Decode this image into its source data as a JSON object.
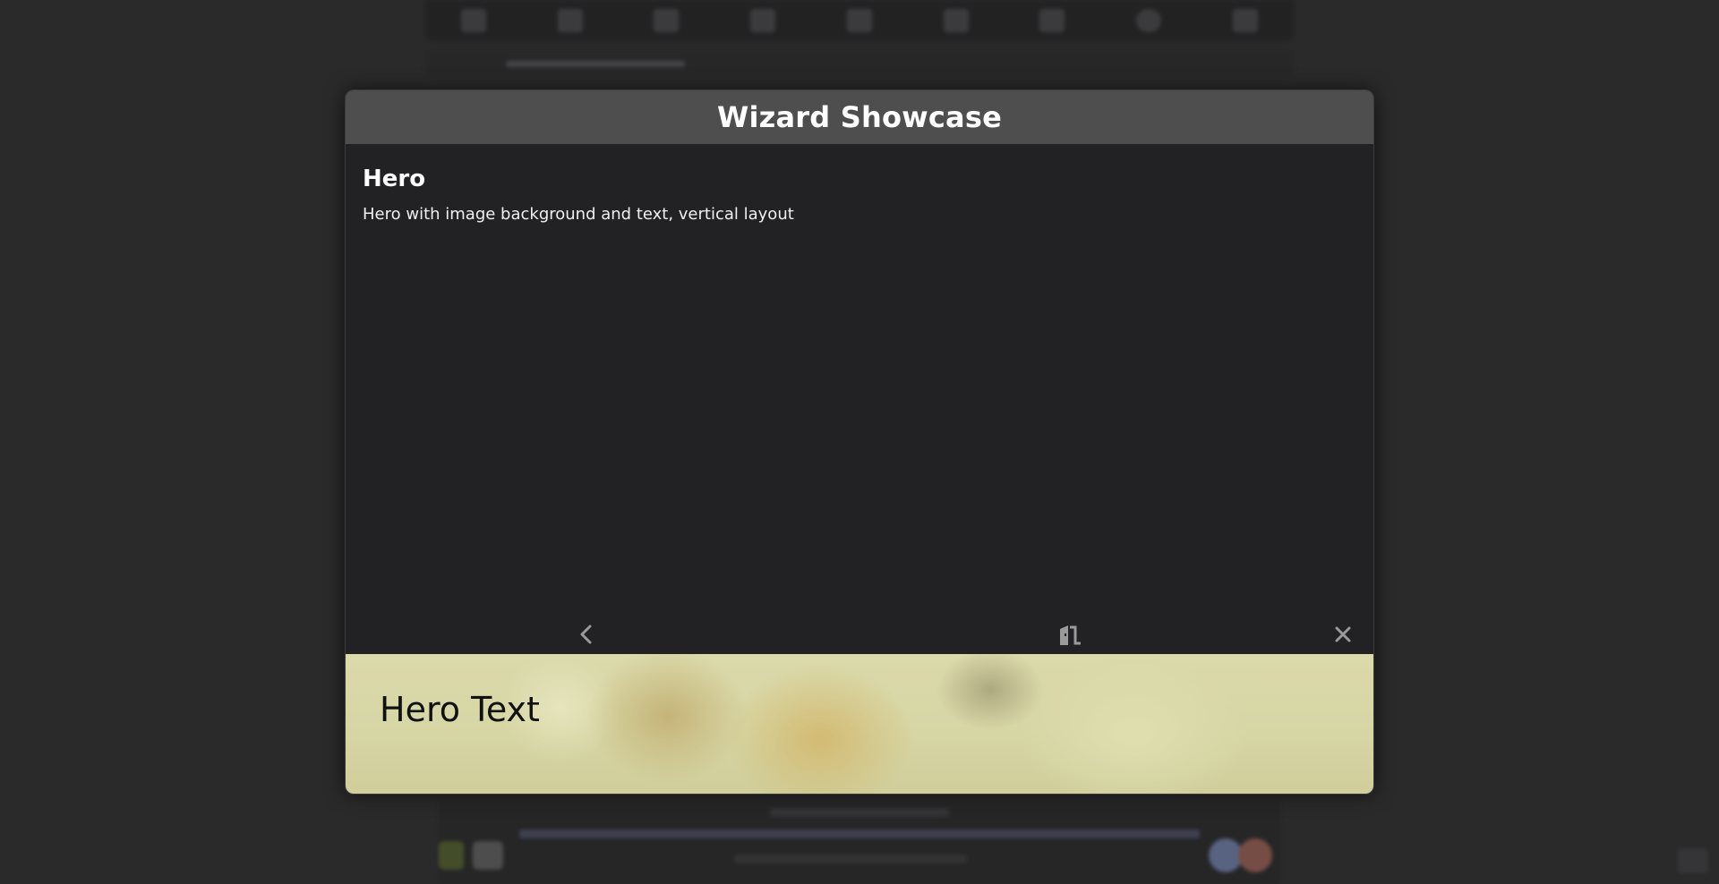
{
  "wizard": {
    "title": "Wizard Showcase",
    "step_title": "Hero",
    "step_description": "Hero with image background and text, vertical layout"
  },
  "nav": {
    "back_icon": "chevron-left-icon",
    "exit_icon": "door-exit-icon",
    "close_icon": "close-icon"
  },
  "hero": {
    "text": "Hero Text"
  },
  "colors": {
    "header_bg": "#4e4e4e",
    "body_bg": "#222123",
    "icon_color": "#9a9a9a",
    "hero_text": "#111111"
  }
}
